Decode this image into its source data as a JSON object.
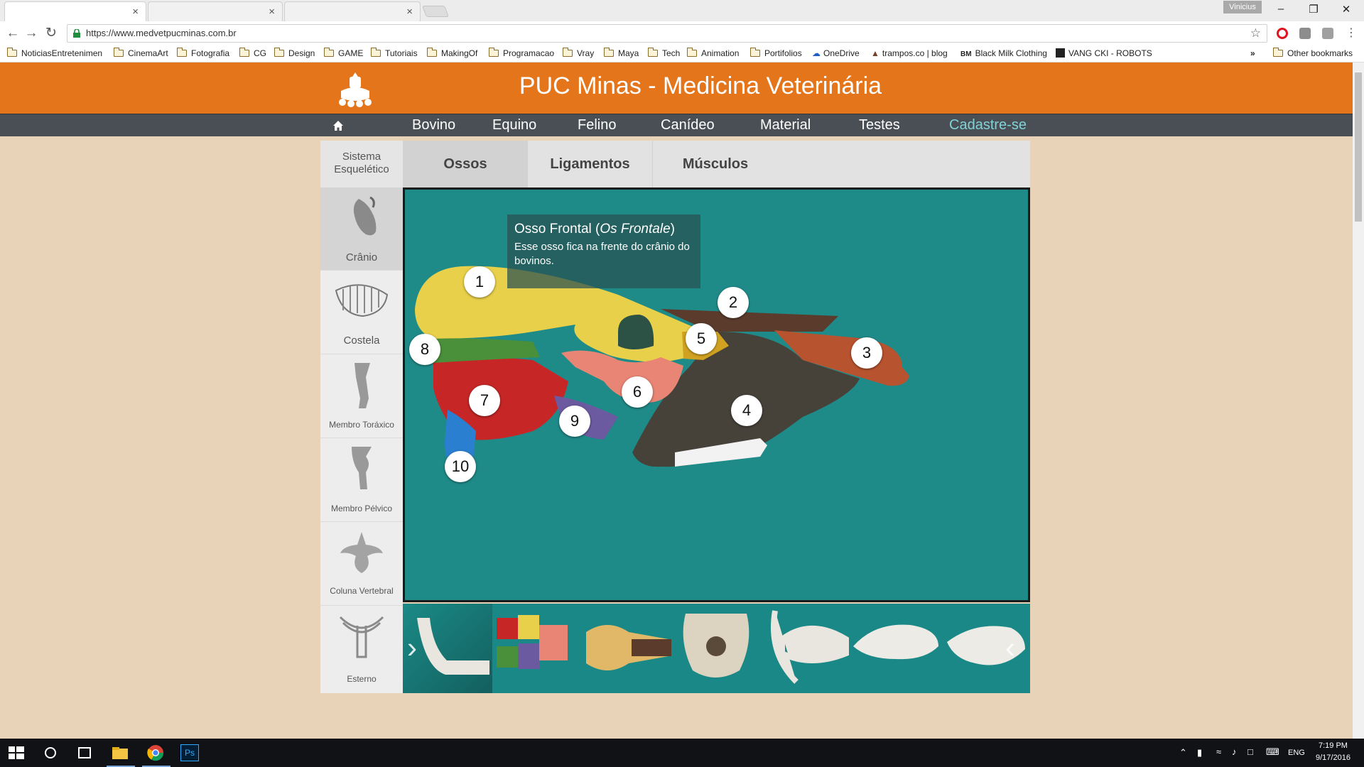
{
  "browser": {
    "tabs": [
      {
        "close": "×"
      },
      {
        "close": "×"
      },
      {
        "close": "×"
      }
    ],
    "user": "Vinicius",
    "url": "https://www.medvetpucminas.com.br",
    "bookmarks": [
      "NoticiasEntretenimen",
      "CinemaArt",
      "Fotografia",
      "CG",
      "Design",
      "GAME",
      "Tutoriais",
      "MakingOf",
      "Programacao",
      "Vray",
      "Maya",
      "Tech",
      "Animation",
      "Portifolios",
      "OneDrive",
      "trampos.co | blog",
      "Black Milk Clothing",
      "VANG CKI - ROBOTS"
    ],
    "bookmarks_more": "»",
    "other_bookmarks": "Other bookmarks",
    "bm_prefix_blackmilk": "BM"
  },
  "site": {
    "title": "PUC Minas - Medicina Veterinária",
    "nav": [
      "Bovino",
      "Equino",
      "Felino",
      "Canídeo",
      "Material",
      "Testes"
    ],
    "nav_register": "Cadastre-se",
    "category_line1": "Sistema",
    "category_line2": "Esquelético",
    "tabs": [
      "Ossos",
      "Ligamentos",
      "Músculos"
    ],
    "sidebar": [
      "Crânio",
      "Costela",
      "Membro Toráxico",
      "Membro Pélvico",
      "Coluna Vertebral",
      "Esterno"
    ],
    "info": {
      "title_main": "Osso Frontal (",
      "title_latin": "Os Frontale",
      "title_end": ")",
      "text": "Esse osso fica na frente do crânio do bovinos."
    },
    "markers": [
      "1",
      "2",
      "3",
      "4",
      "5",
      "6",
      "7",
      "8",
      "9",
      "10"
    ]
  },
  "taskbar": {
    "lang": "ENG",
    "time": "7:19 PM",
    "date": "9/17/2016",
    "ps_label": "Ps"
  },
  "colors": {
    "header": "#e4751b",
    "nav": "#4a4f56",
    "accent": "#7fd3d6",
    "stage_bg": "#1f8b89",
    "page_bg": "#e8d3b9"
  }
}
